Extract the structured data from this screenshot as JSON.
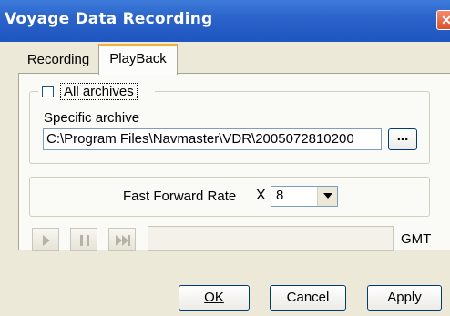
{
  "window": {
    "title": "Voyage Data Recording",
    "close_glyph": "✕"
  },
  "tabs": [
    {
      "label": "Recording",
      "selected": false
    },
    {
      "label": "PlayBack",
      "selected": true
    }
  ],
  "archive": {
    "all_archives_label": "All archives",
    "all_archives_checked": false,
    "specific_label": "Specific archive",
    "path_value": "C:\\Program Files\\Navmaster\\VDR\\2005072810200",
    "browse_label": "..."
  },
  "rate": {
    "label": "Fast Forward Rate",
    "multiplier": "X",
    "selected_value": "8"
  },
  "playback": {
    "timezone_label": "GMT",
    "controls_enabled": false,
    "icons": [
      "play-icon",
      "pause-icon",
      "fast-forward-icon"
    ]
  },
  "buttons": {
    "ok": "OK",
    "cancel": "Cancel",
    "apply": "Apply"
  },
  "colors": {
    "titlebar": "#2a62c9",
    "close": "#d9532f",
    "active_tab_accent": "#f2b23a",
    "disabled_icon": "#b5b3a6"
  }
}
